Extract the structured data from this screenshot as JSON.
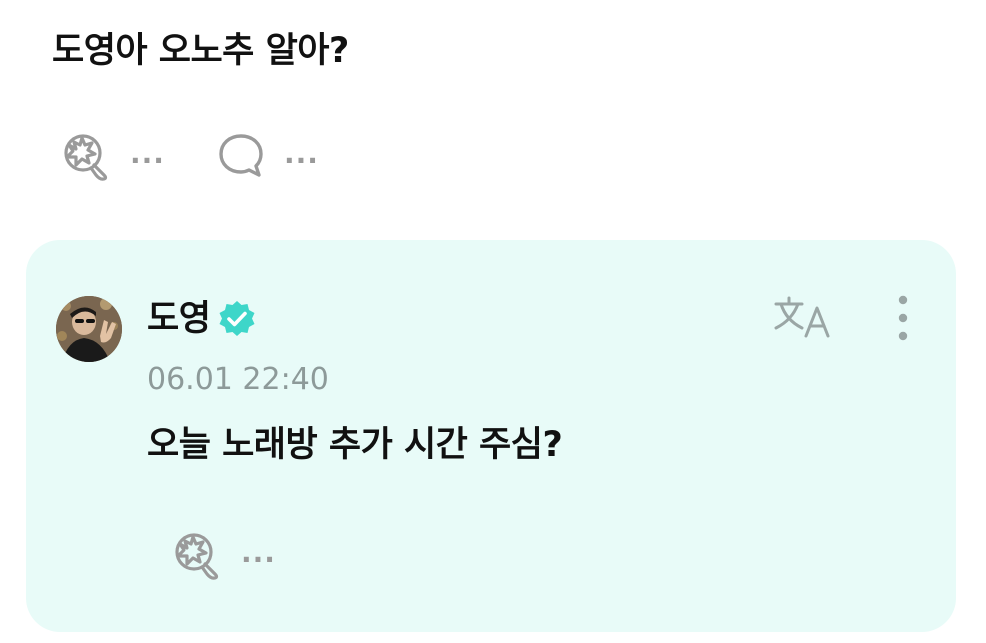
{
  "post": {
    "text": "도영아 오노추 알아?",
    "like_count": "...",
    "comment_count": "..."
  },
  "reply": {
    "author": "도영",
    "verified": true,
    "timestamp": "06.01 22:40",
    "text": "오늘 노래방 추가 시간 주심?",
    "like_count": "..."
  },
  "icons": {
    "like": "like-reaction-icon",
    "comment": "comment-bubble-icon",
    "translate": "translate-icon",
    "more": "more-vertical-icon",
    "verified": "verified-badge-icon"
  },
  "colors": {
    "reply_card_bg": "#e8fbf8",
    "verified_badge": "#3ed6c9",
    "muted_text": "#8d9a99",
    "icon_gray": "#9a9a9a"
  }
}
